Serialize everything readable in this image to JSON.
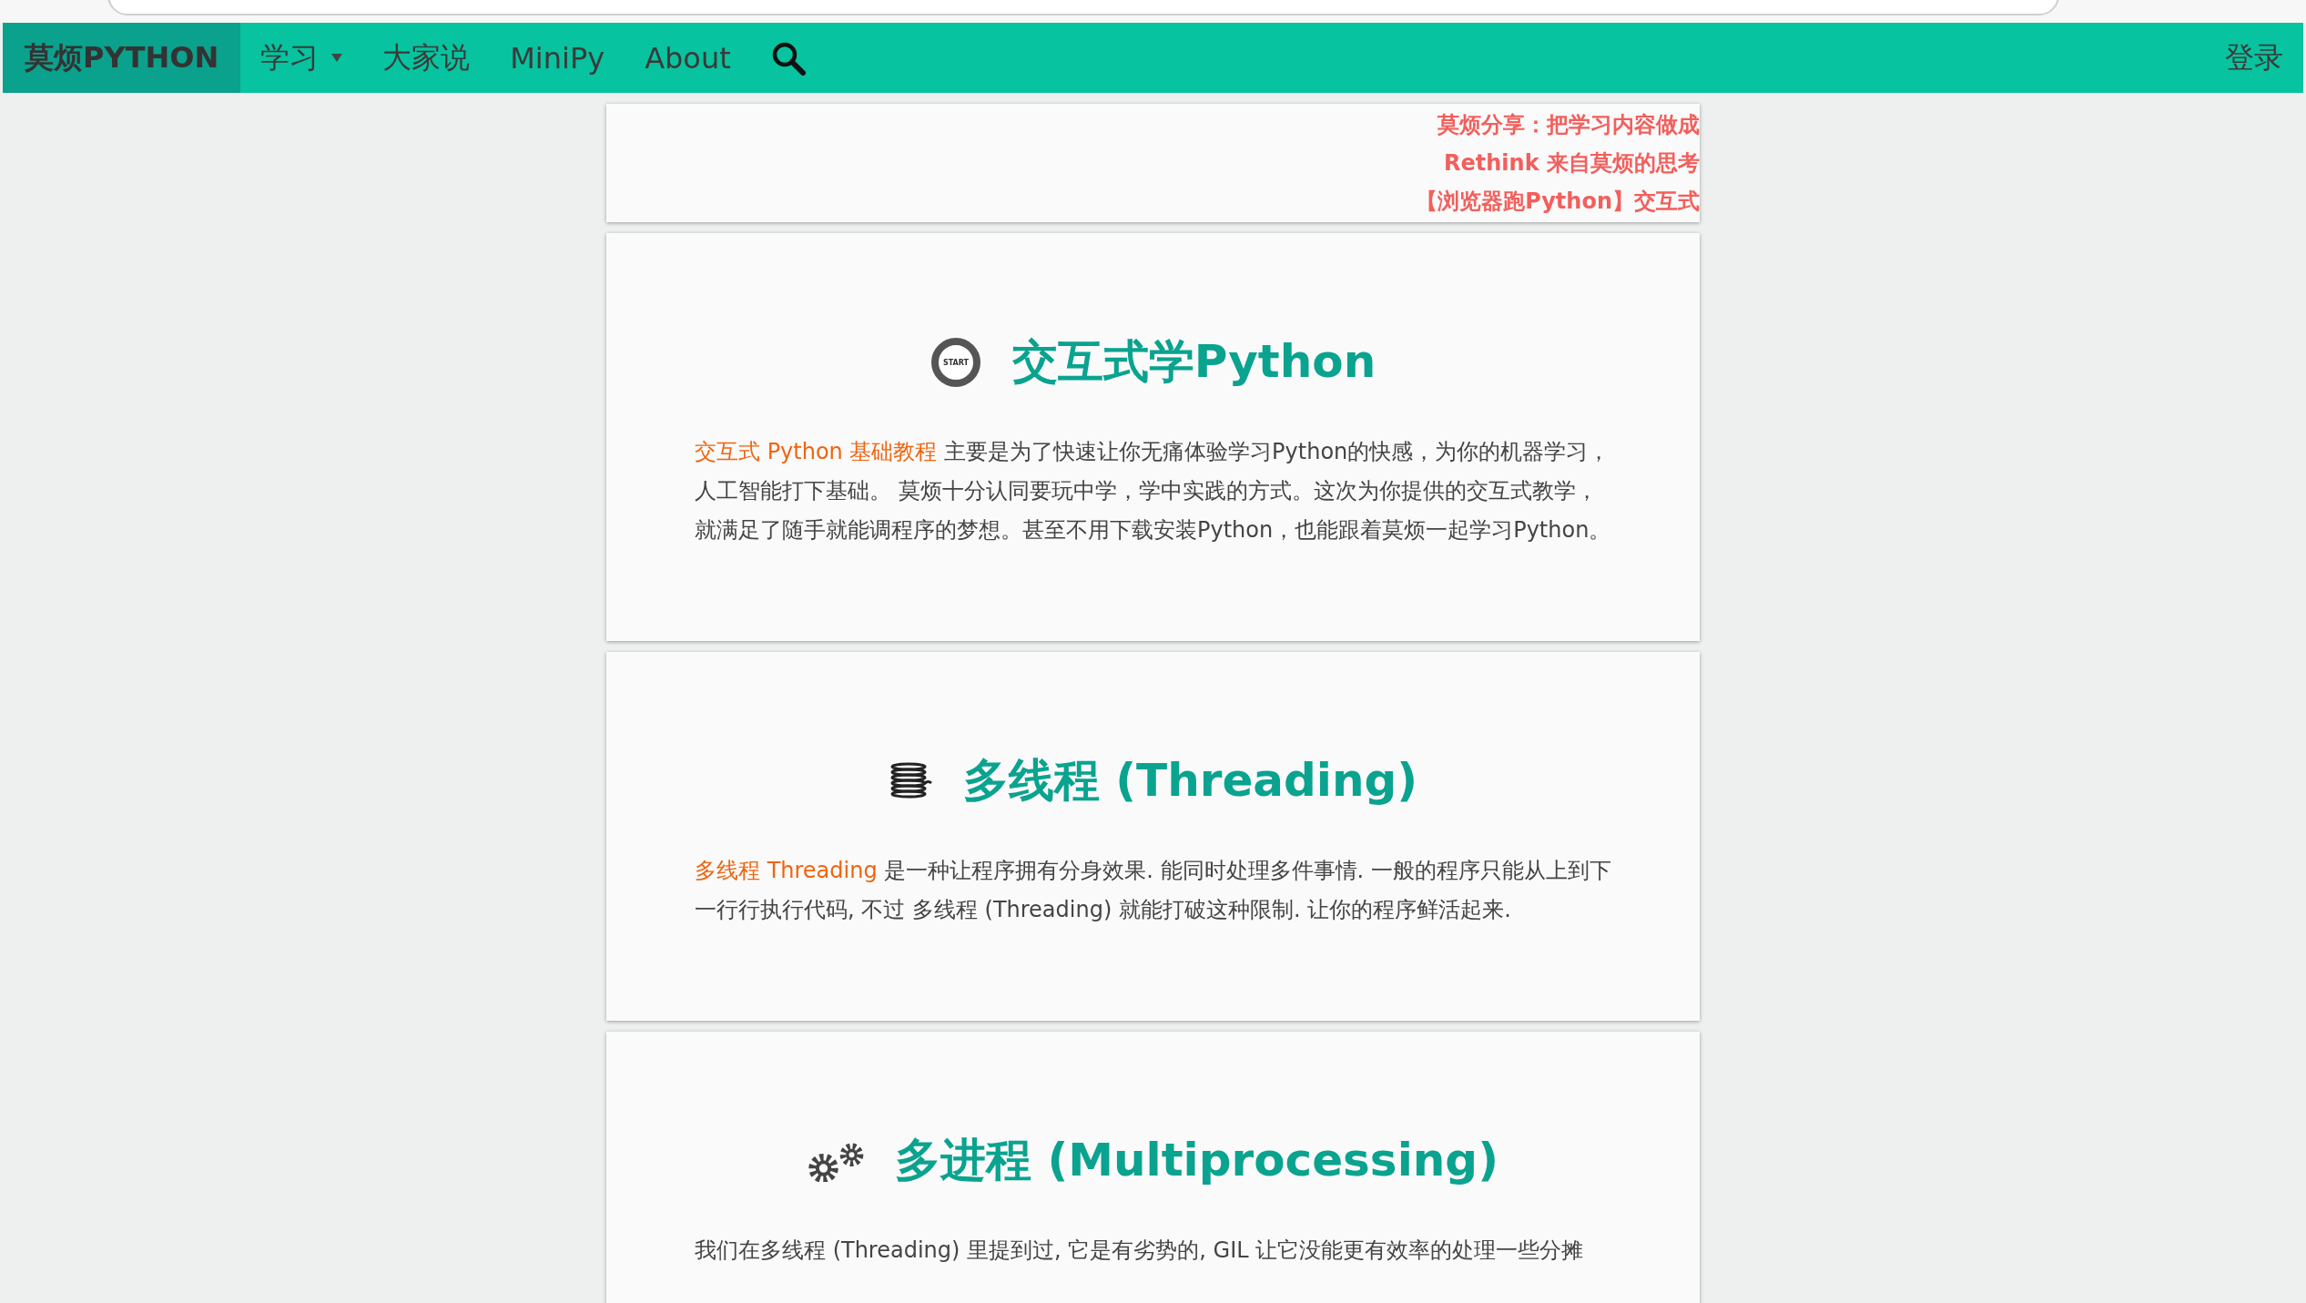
{
  "navbar": {
    "brand": "莫烦PYTHON",
    "items": [
      {
        "label": "学习",
        "kind": "dropdown"
      },
      {
        "label": "大家说",
        "kind": "link"
      },
      {
        "label": "MiniPy",
        "kind": "link"
      },
      {
        "label": "About",
        "kind": "link"
      },
      {
        "kind": "search"
      }
    ],
    "login": "登录"
  },
  "announcements": [
    "莫烦分享：把学习内容做成",
    "Rethink 来自莫烦的思考",
    "【浏览器跑Python】交互式"
  ],
  "cards": [
    {
      "kind": "start",
      "icon_label": "START",
      "title": "交互式学Python",
      "link_text": "交互式 Python 基础教程",
      "text": " 主要是为了快速让你无痛体验学习Python的快感，为你的机器学习，人工智能打下基础。 莫烦十分认同要玩中学，学中实践的方式。这次为你提供的交互式教学，就满足了随手就能调程序的梦想。甚至不用下载安装Python，也能跟着莫烦一起学习Python。"
    },
    {
      "kind": "spool",
      "title": "多线程 (Threading)",
      "link_text": "多线程 Threading",
      "text": " 是一种让程序拥有分身效果. 能同时处理多件事情. 一般的程序只能从上到下一行行执行代码, 不过 多线程 (Threading) 就能打破这种限制. 让你的程序鲜活起来."
    },
    {
      "kind": "gears",
      "title": "多进程 (Multiprocessing)",
      "text": "我们在多线程 (Threading) 里提到过, 它是有劣势的, GIL 让它没能更有效率的处理一些分摊"
    }
  ]
}
